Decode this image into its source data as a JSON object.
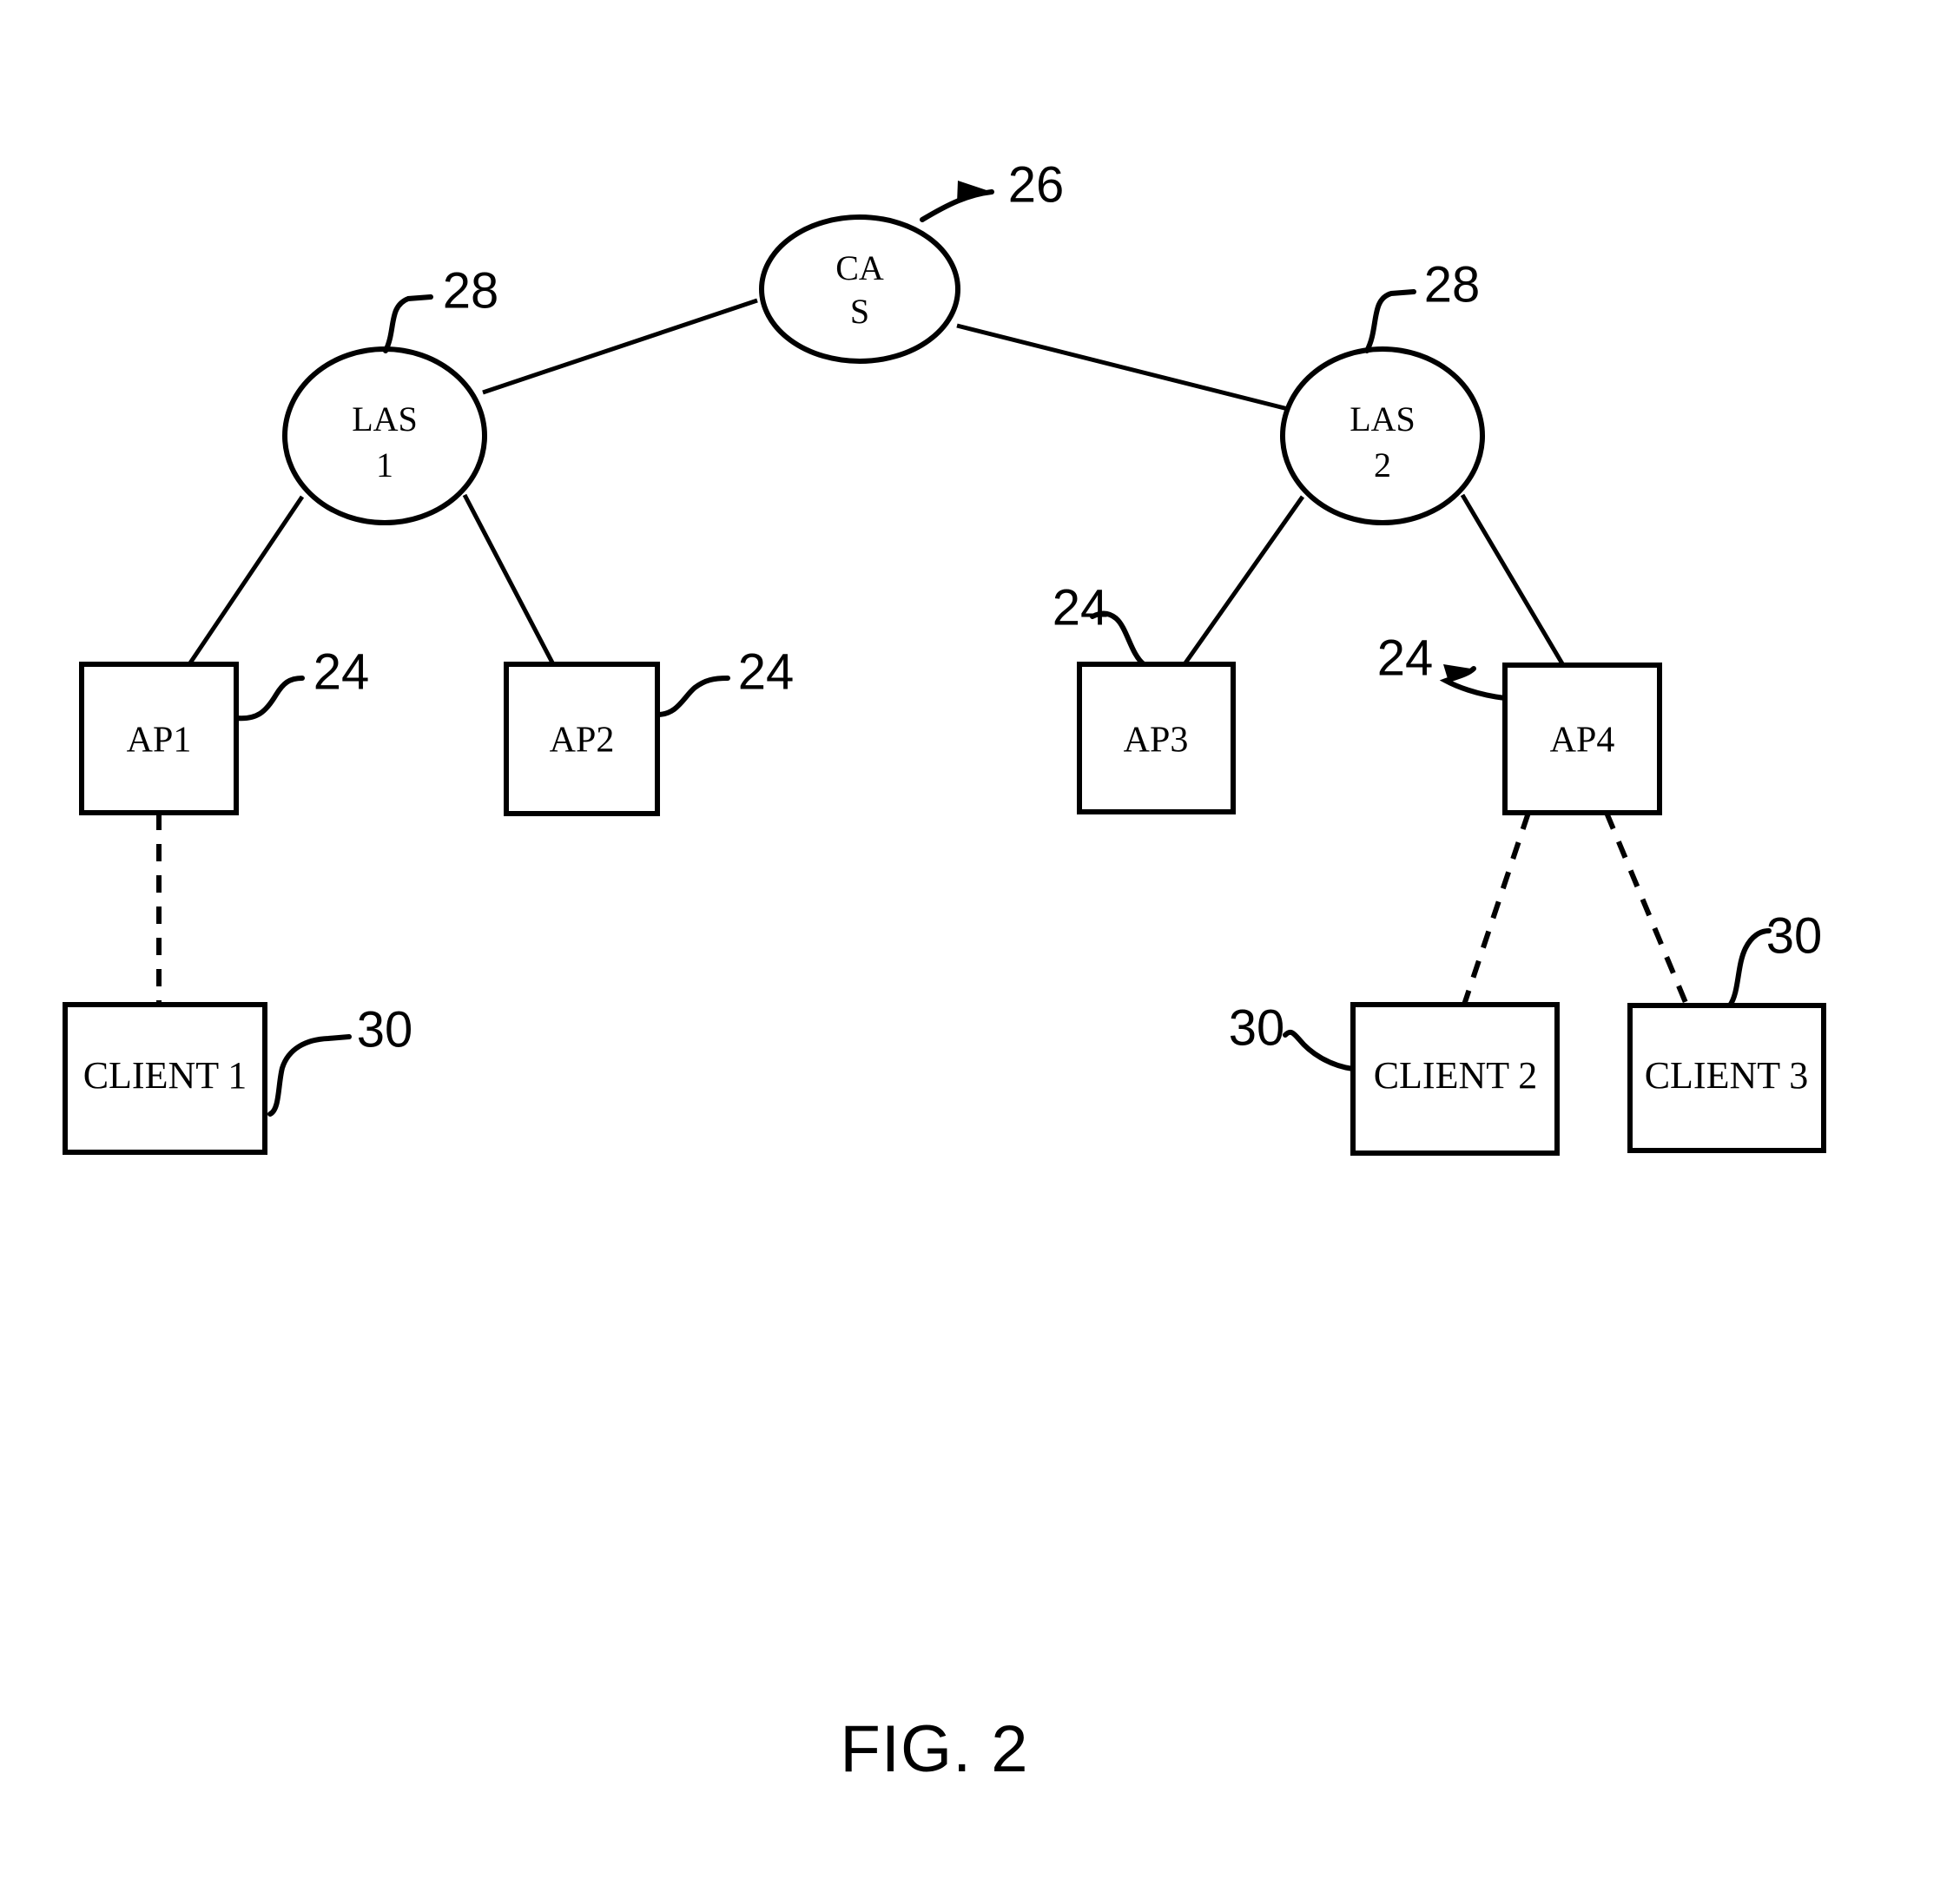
{
  "figure": {
    "caption": "FIG. 2",
    "title": "FIG. 2"
  },
  "nodes": {
    "cas": {
      "label_line1": "CA",
      "label_line2": "S",
      "ref": "26",
      "shape": "ellipse"
    },
    "las1": {
      "label_line1": "LAS",
      "label_line2": "1",
      "ref": "28",
      "shape": "ellipse"
    },
    "las2": {
      "label_line1": "LAS",
      "label_line2": "2",
      "ref": "28",
      "shape": "ellipse"
    },
    "ap1": {
      "label": "AP1",
      "ref": "24",
      "shape": "rectangle"
    },
    "ap2": {
      "label": "AP2",
      "ref": "24",
      "shape": "rectangle"
    },
    "ap3": {
      "label": "AP3",
      "ref": "24",
      "shape": "rectangle"
    },
    "ap4": {
      "label": "AP4",
      "ref": "24",
      "shape": "rectangle"
    },
    "client1": {
      "label": "CLIENT 1",
      "ref": "30",
      "shape": "rectangle"
    },
    "client2": {
      "label": "CLIENT 2",
      "ref": "30",
      "shape": "rectangle"
    },
    "client3": {
      "label": "CLIENT 3",
      "ref": "30",
      "shape": "rectangle"
    }
  },
  "colors": {
    "ink": "#000000",
    "paper": "#ffffff"
  },
  "chart_data": {
    "type": "diagram",
    "title": "FIG. 2",
    "description": "Hierarchical wireless network topology diagram",
    "node_list": [
      {
        "id": "cas",
        "label": "CAS",
        "ref": "26",
        "shape": "ellipse",
        "level": 0
      },
      {
        "id": "las1",
        "label": "LAS 1",
        "ref": "28",
        "shape": "ellipse",
        "level": 1
      },
      {
        "id": "las2",
        "label": "LAS 2",
        "ref": "28",
        "shape": "ellipse",
        "level": 1
      },
      {
        "id": "ap1",
        "label": "AP1",
        "ref": "24",
        "shape": "rectangle",
        "level": 2
      },
      {
        "id": "ap2",
        "label": "AP2",
        "ref": "24",
        "shape": "rectangle",
        "level": 2
      },
      {
        "id": "ap3",
        "label": "AP3",
        "ref": "24",
        "shape": "rectangle",
        "level": 2
      },
      {
        "id": "ap4",
        "label": "AP4",
        "ref": "24",
        "shape": "rectangle",
        "level": 2
      },
      {
        "id": "client1",
        "label": "CLIENT 1",
        "ref": "30",
        "shape": "rectangle",
        "level": 3
      },
      {
        "id": "client2",
        "label": "CLIENT 2",
        "ref": "30",
        "shape": "rectangle",
        "level": 3
      },
      {
        "id": "client3",
        "label": "CLIENT 3",
        "ref": "30",
        "shape": "rectangle",
        "level": 3
      }
    ],
    "edges": [
      {
        "from": "cas",
        "to": "las1",
        "style": "solid"
      },
      {
        "from": "cas",
        "to": "las2",
        "style": "solid"
      },
      {
        "from": "las1",
        "to": "ap1",
        "style": "solid"
      },
      {
        "from": "las1",
        "to": "ap2",
        "style": "solid"
      },
      {
        "from": "las2",
        "to": "ap3",
        "style": "solid"
      },
      {
        "from": "las2",
        "to": "ap4",
        "style": "solid"
      },
      {
        "from": "ap1",
        "to": "client1",
        "style": "dashed"
      },
      {
        "from": "ap4",
        "to": "client2",
        "style": "dashed"
      },
      {
        "from": "ap4",
        "to": "client3",
        "style": "dashed"
      }
    ],
    "reference_numerals": [
      "24",
      "26",
      "28",
      "30"
    ]
  }
}
